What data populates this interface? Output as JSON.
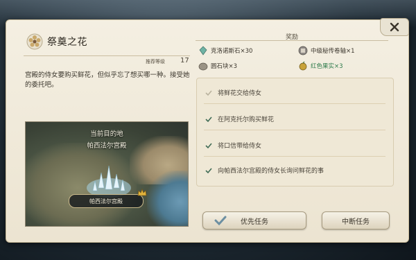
{
  "quest": {
    "title": "祭奠之花",
    "level_label": "推荐等级",
    "level_value": "17",
    "description": "宫殿的侍女要购买鲜花，但似乎忘了想买哪一种。接受她的委托吧。"
  },
  "map": {
    "current_label": "当前目的地",
    "destination": "帕西法尔宫殿",
    "place_tag": "帕西法尔宫殿"
  },
  "rewards": {
    "title": "奖励",
    "items": [
      {
        "label": "克洛诺斯石×30",
        "icon": "crystal-icon"
      },
      {
        "label": "中级秘传卷轴×1",
        "icon": "scroll-icon"
      },
      {
        "label": "圆石块×3",
        "icon": "stone-icon"
      },
      {
        "label": "红色果实×3",
        "icon": "fruit-icon",
        "highlight_color": "#2c7a4a"
      }
    ]
  },
  "tasks": [
    {
      "label": "将鲜花交给侍女",
      "done": false
    },
    {
      "label": "在阿克托尔购买鲜花",
      "done": true
    },
    {
      "label": "将口信带给侍女",
      "done": true
    },
    {
      "label": "向帕西法尔宫殿的侍女长询问鲜花的事",
      "done": true
    }
  ],
  "buttons": {
    "priority": "优先任务",
    "abort": "中断任务",
    "close": "×"
  },
  "colors": {
    "panel": "#f4efe2",
    "accent_green": "#2c7a4a",
    "check_done": "#3f6b55",
    "check_pending": "#b9b29e"
  }
}
